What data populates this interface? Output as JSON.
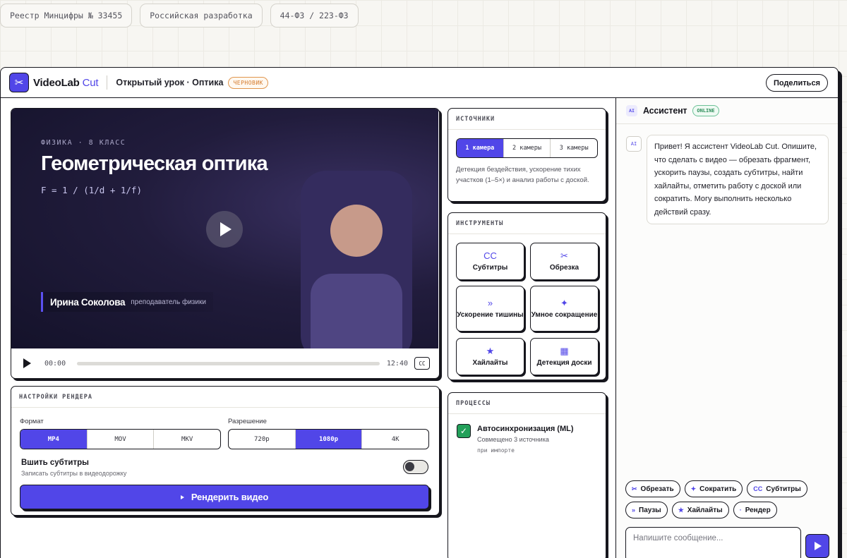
{
  "badges": [
    "Реестр Минцифры № 33455",
    "Российская разработка",
    "44-ФЗ / 223-ФЗ"
  ],
  "header": {
    "brand_main": "VideoLab",
    "brand_accent": "Cut",
    "project_title": "Открытый урок · Оптика",
    "status_badge": "ЧЕРНОВИК",
    "share_label": "Поделиться"
  },
  "video": {
    "subject_tag": "ФИЗИКА · 8 КЛАСС",
    "title": "Геометрическая оптика",
    "formula": "F = 1 / (1/d + 1/f)",
    "presenter_name": "Ирина Соколова",
    "presenter_role": "преподаватель физики",
    "time_current": "00:00",
    "time_total": "12:40",
    "cc_label": "CC",
    "progress": 0
  },
  "render": {
    "heading": "НАСТРОЙКИ РЕНДЕРА",
    "format_label": "Формат",
    "formats": [
      "MP4",
      "MOV",
      "MKV"
    ],
    "format_selected": "MP4",
    "resolution_label": "Разрешение",
    "resolutions": [
      "720p",
      "1080p",
      "4K"
    ],
    "resolution_selected": "1080p",
    "burn_title": "Вшить субтитры",
    "burn_sub": "Записать субтитры в видеодорожку",
    "burn_enabled": false,
    "button_label": "Рендерить видео"
  },
  "sources": {
    "heading": "ИСТОЧНИКИ",
    "options": [
      "1 камера",
      "2 камеры",
      "3 камеры"
    ],
    "selected": "1 камера",
    "description": "Детекция бездействия, ускорение тихих участков (1–5×) и анализ работы с доской."
  },
  "tools": {
    "heading": "ИНСТРУМЕНТЫ",
    "items": [
      {
        "label": "Субтитры",
        "icon": "CC"
      },
      {
        "label": "Обрезка",
        "icon": "✂"
      },
      {
        "label": "Ускорение тишины",
        "icon": "»"
      },
      {
        "label": "Умное сокращение",
        "icon": "✦"
      },
      {
        "label": "Хайлайты",
        "icon": "★"
      },
      {
        "label": "Детекция доски",
        "icon": "▦"
      }
    ]
  },
  "processes": {
    "heading": "ПРОЦЕССЫ",
    "items": [
      {
        "title": "Автосинхронизация (ML)",
        "subtitle": "Совмещено 3 источника",
        "time": "при импорте",
        "done": true
      }
    ]
  },
  "assistant": {
    "ai_chip": "AI",
    "title": "Ассистент",
    "status": "ONLINE",
    "avatar": "AI",
    "message": "Привет! Я ассистент VideoLab Cut. Опишите, что сделать с видео — обрезать фрагмент, ускорить паузы, создать субтитры, найти хайлайты, отметить работу с доской или сократить. Могу выполнить несколько действий сразу.",
    "chips": [
      {
        "icon": "✂",
        "label": "Обрезать"
      },
      {
        "icon": "✦",
        "label": "Сократить"
      },
      {
        "icon": "CC",
        "label": "Субтитры"
      },
      {
        "icon": "»",
        "label": "Паузы"
      },
      {
        "icon": "★",
        "label": "Хайлайты"
      },
      {
        "icon": "·",
        "label": "Рендер"
      }
    ],
    "input_placeholder": "Напишите сообщение...",
    "input_value": ""
  },
  "colors": {
    "accent": "#5146e8",
    "success": "#23a05a",
    "draft": "#d4792a"
  }
}
